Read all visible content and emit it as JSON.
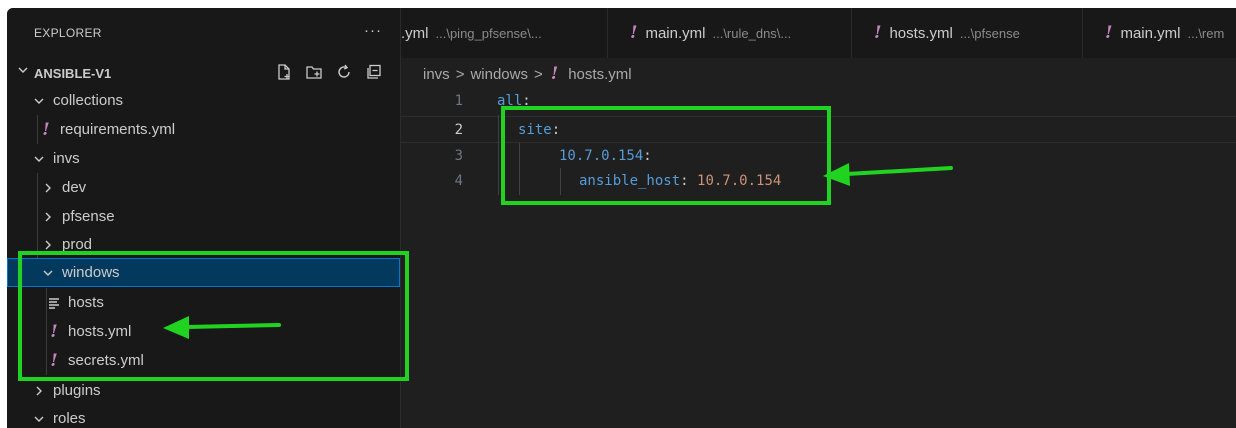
{
  "explorer": {
    "title": "EXPLORER",
    "more_label": "···",
    "root_label": "ANSIBLE-V1",
    "toolbar_icons": [
      "new-file-icon",
      "new-folder-icon",
      "refresh-icon",
      "collapse-all-icon"
    ],
    "tree": [
      {
        "label": "collections",
        "type": "folder",
        "expanded": true
      },
      {
        "label": "requirements.yml",
        "type": "yml"
      },
      {
        "label": "invs",
        "type": "folder",
        "expanded": true
      },
      {
        "label": "dev",
        "type": "folder",
        "expanded": false
      },
      {
        "label": "pfsense",
        "type": "folder",
        "expanded": false
      },
      {
        "label": "prod",
        "type": "folder",
        "expanded": false
      },
      {
        "label": "windows",
        "type": "folder",
        "expanded": true,
        "selected": true
      },
      {
        "label": "hosts",
        "type": "text"
      },
      {
        "label": "hosts.yml",
        "type": "yml"
      },
      {
        "label": "secrets.yml",
        "type": "yml"
      },
      {
        "label": "plugins",
        "type": "folder",
        "expanded": false
      },
      {
        "label": "roles",
        "type": "folder",
        "expanded": true
      }
    ]
  },
  "tabs": [
    {
      "label": ".yml",
      "desc": "...\\ping_pfsense\\..."
    },
    {
      "label": "main.yml",
      "desc": "...\\rule_dns\\..."
    },
    {
      "label": "hosts.yml",
      "desc": "...\\pfsense"
    },
    {
      "label": "main.yml",
      "desc": "...\\rem"
    }
  ],
  "breadcrumb": {
    "items": [
      "invs",
      "windows"
    ],
    "file": "hosts.yml",
    "separator": ">"
  },
  "code": {
    "lines": [
      {
        "number": "1",
        "key": "all",
        "value": ""
      },
      {
        "number": "2",
        "key": "site",
        "value": ""
      },
      {
        "number": "3",
        "key": "10.7.0.154",
        "value": ""
      },
      {
        "number": "4",
        "key": "ansible_host",
        "value": "10.7.0.154"
      }
    ],
    "current_line": "2"
  },
  "colors": {
    "annotation": "#21d321",
    "yaml_icon": "#c586c0",
    "yaml_key": "#569cd6",
    "yaml_value": "#ce9178",
    "selection": "#04395e"
  }
}
